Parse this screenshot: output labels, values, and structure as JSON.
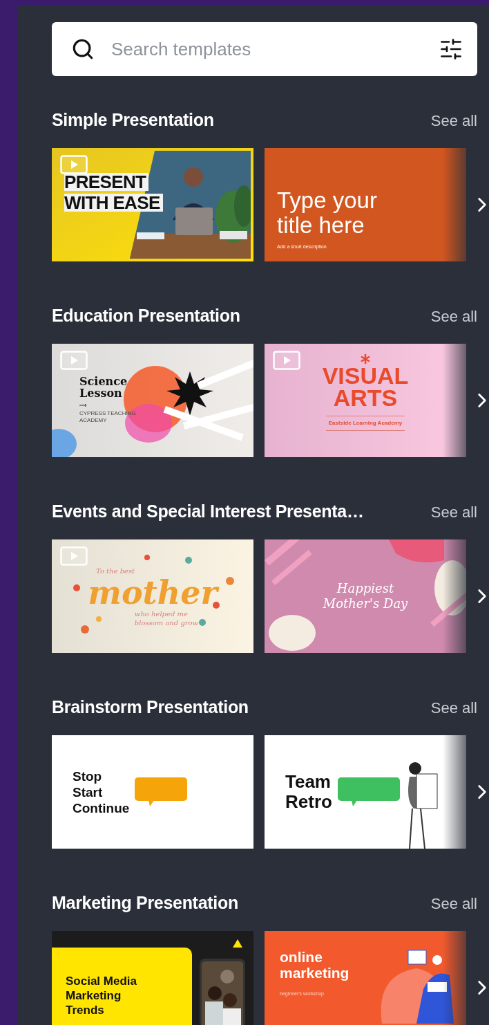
{
  "search": {
    "placeholder": "Search templates"
  },
  "sections": [
    {
      "title": "Simple Presentation",
      "see_all": "See all",
      "templates": [
        {
          "kind": "photo-banner",
          "video": true,
          "lines": [
            "PRESENT",
            "WITH EASE"
          ]
        },
        {
          "kind": "title-slide",
          "video": false,
          "lines": [
            "Type your",
            "title here"
          ],
          "caption": "Add a short description"
        }
      ]
    },
    {
      "title": "Education Presentation",
      "see_all": "See all",
      "templates": [
        {
          "kind": "lesson",
          "video": true,
          "lines": [
            "Science",
            "Lesson"
          ],
          "caption": "CYPRESS TEACHING ACADEMY"
        },
        {
          "kind": "arts",
          "video": true,
          "lines": [
            "VISUAL",
            "ARTS"
          ],
          "caption": "Eastside Learning Academy"
        }
      ]
    },
    {
      "title": "Events and Special Interest Presenta…",
      "see_all": "See all",
      "templates": [
        {
          "kind": "lettering",
          "video": true,
          "lines": [
            "To the best",
            "mother",
            "who helped me",
            "blossom and grow"
          ]
        },
        {
          "kind": "floral",
          "video": false,
          "lines": [
            "Happiest",
            "Mother's Day"
          ]
        }
      ]
    },
    {
      "title": "Brainstorm Presentation",
      "see_all": "See all",
      "templates": [
        {
          "kind": "bubble-orange",
          "video": false,
          "lines": [
            "Stop",
            "Start",
            "Continue"
          ]
        },
        {
          "kind": "bubble-green",
          "video": false,
          "lines": [
            "Team",
            "Retro"
          ]
        }
      ]
    },
    {
      "title": "Marketing Presentation",
      "see_all": "See all",
      "templates": [
        {
          "kind": "phone-promo",
          "video": false,
          "lines": [
            "Social Media",
            "Marketing",
            "Trends"
          ]
        },
        {
          "kind": "illustrated",
          "video": false,
          "lines": [
            "online",
            "marketing"
          ],
          "caption": "beginner's workshop"
        }
      ]
    }
  ]
}
